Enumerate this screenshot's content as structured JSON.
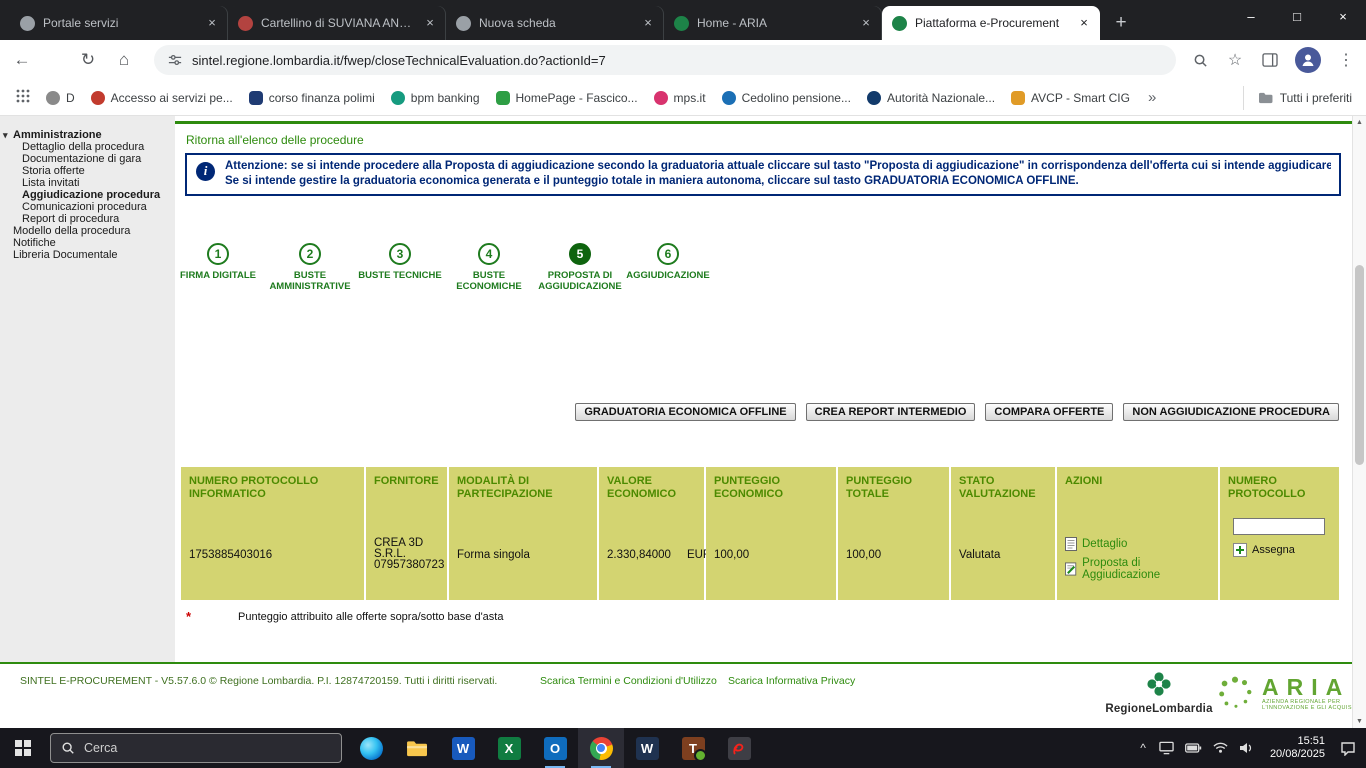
{
  "colors": {
    "accent-green": "#2e8b0e",
    "step-green": "#1e7b1e",
    "step-green-dark": "#0e640e",
    "notice-blue": "#002776",
    "table-bg": "#d3d471",
    "table-head": "#4c8a00",
    "footer-text": "#3f7020",
    "tabstrip-bg": "#202124",
    "taskbar-bg": "#17171d",
    "aria-green": "#62a532",
    "regione-green": "#1d8348"
  },
  "icons": {
    "back": "←",
    "refresh": "↻",
    "home": "⌂",
    "star": "☆",
    "menu": "⋮",
    "tab_close": "×",
    "new_tab": "+",
    "minimize": "–",
    "maximize": "□",
    "close": "×",
    "chevron_double": "»",
    "tree_collapse": "▾",
    "info": "i",
    "up_arrow": "▲",
    "down_arrow": "▼",
    "chevron_up": "^"
  },
  "browser": {
    "tabs": [
      {
        "title": "Portale servizi"
      },
      {
        "title": "Cartellino di SUVIANA ANTO"
      },
      {
        "title": "Nuova scheda"
      },
      {
        "title": "Home - ARIA"
      },
      {
        "title": "Piattaforma e-Procurement"
      }
    ],
    "url": "sintel.regione.lombardia.it/fwep/closeTechnicalEvaluation.do?actionId=7",
    "bookmarks": [
      {
        "label": "D"
      },
      {
        "label": "Accesso ai servizi pe..."
      },
      {
        "label": "corso finanza polimi"
      },
      {
        "label": "bpm banking"
      },
      {
        "label": "HomePage - Fascico..."
      },
      {
        "label": "mps.it"
      },
      {
        "label": "Cedolino pensione..."
      },
      {
        "label": "Autorità Nazionale..."
      },
      {
        "label": "AVCP - Smart CIG"
      }
    ],
    "all_favorites": "Tutti i preferiti"
  },
  "sidebar": {
    "items": [
      {
        "label": "Amministrazione"
      },
      {
        "label": "Dettaglio della procedura"
      },
      {
        "label": "Documentazione di gara"
      },
      {
        "label": "Storia offerte"
      },
      {
        "label": "Lista invitati"
      },
      {
        "label": "Aggiudicazione procedura"
      },
      {
        "label": "Comunicazioni procedura"
      },
      {
        "label": "Report di procedura"
      },
      {
        "label": "Modello della procedura"
      },
      {
        "label": "Notifiche"
      },
      {
        "label": "Libreria Documentale"
      }
    ]
  },
  "main": {
    "back_link": "Ritorna all'elenco delle procedure",
    "notice": {
      "line1": "Attenzione: se si intende procedere alla Proposta di aggiudicazione secondo la graduatoria attuale cliccare sul tasto \"Proposta di aggiudicazione\" in corrispondenza dell'offerta cui si intende aggiudicare.",
      "line2": "Se si intende gestire la graduatoria economica generata e il punteggio totale in maniera autonoma, cliccare sul tasto GRADUATORIA ECONOMICA OFFLINE."
    },
    "steps": [
      {
        "num": "1",
        "label": "FIRMA DIGITALE"
      },
      {
        "num": "2",
        "label": "BUSTE AMMINISTRATIVE"
      },
      {
        "num": "3",
        "label": "BUSTE TECNICHE"
      },
      {
        "num": "4",
        "label": "BUSTE ECONOMICHE"
      },
      {
        "num": "5",
        "label": "PROPOSTA DI AGGIUDICAZIONE"
      },
      {
        "num": "6",
        "label": "AGGIUDICAZIONE"
      }
    ],
    "buttons": [
      "GRADUATORIA ECONOMICA OFFLINE",
      "CREA REPORT INTERMEDIO",
      "COMPARA OFFERTE",
      "NON AGGIUDICAZIONE PROCEDURA"
    ],
    "table": {
      "headers": [
        "NUMERO PROTOCOLLO INFORMATICO",
        "FORNITORE",
        "MODALITÀ DI PARTECIPAZIONE",
        "VALORE ECONOMICO",
        "PUNTEGGIO ECONOMICO",
        "PUNTEGGIO TOTALE",
        "STATO VALUTAZIONE",
        "AZIONI",
        "NUMERO PROTOCOLLO"
      ],
      "row": {
        "numero_protocollo_informatico": "1753885403016",
        "fornitore": [
          "CREA 3D",
          "S.R.L.",
          "07957380723"
        ],
        "modalita_partecipazione": "Forma singola",
        "valore_economico": "2.330,84000",
        "valuta": "EUR",
        "punteggio_economico": "100,00",
        "punteggio_totale": "100,00",
        "stato_valutazione": "Valutata",
        "azioni": [
          "Dettaglio",
          "Proposta di Aggiudicazione"
        ],
        "assegna_label": "Assegna",
        "protocollo_input_value": ""
      }
    },
    "footnote": {
      "marker": "*",
      "text": "Punteggio attribuito alle offerte sopra/sotto base d'asta"
    }
  },
  "footer": {
    "copyright": "SINTEL E-PROCUREMENT - V5.57.6.0 © Regione Lombardia. P.I. 12874720159. Tutti i diritti riservati.",
    "links": [
      "Scarica Termini e Condizioni d'Utilizzo",
      "Scarica Informativa Privacy"
    ],
    "regione_logo_text": "RegioneLombardia",
    "aria_logo_text": "ARIA",
    "aria_logo_subtitle": "AZIENDA REGIONALE PER L'INNOVAZIONE E GLI ACQUISTI"
  },
  "taskbar": {
    "search_placeholder": "Cerca",
    "time": "15:51",
    "date": "20/08/2025"
  }
}
